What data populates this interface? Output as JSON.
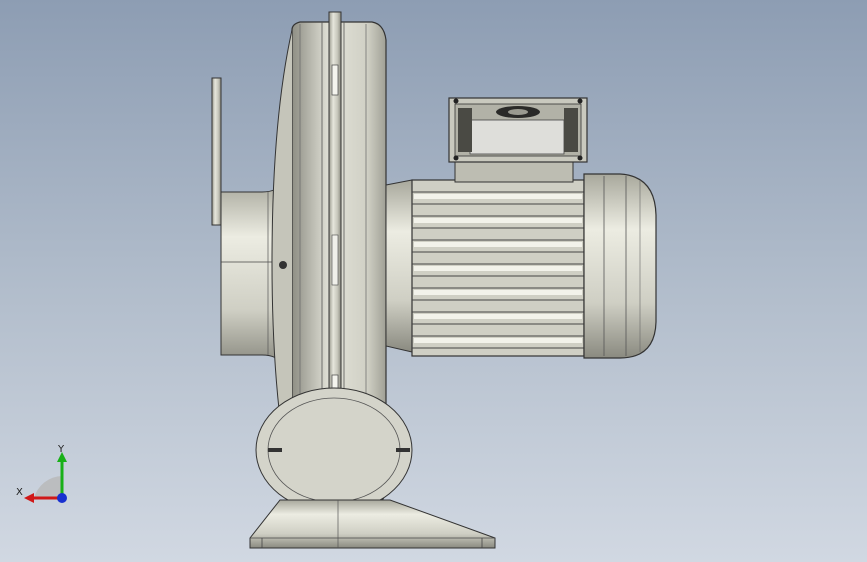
{
  "viewport": {
    "background_top": "#8d9db3",
    "background_bottom": "#d1d8e2"
  },
  "model": {
    "icon": "centrifugal-blower-motor-icon"
  },
  "triad": {
    "x_label": "X",
    "y_label": "Y",
    "x_color": "#d01818",
    "y_color": "#18b018",
    "z_color": "#1830d0"
  }
}
